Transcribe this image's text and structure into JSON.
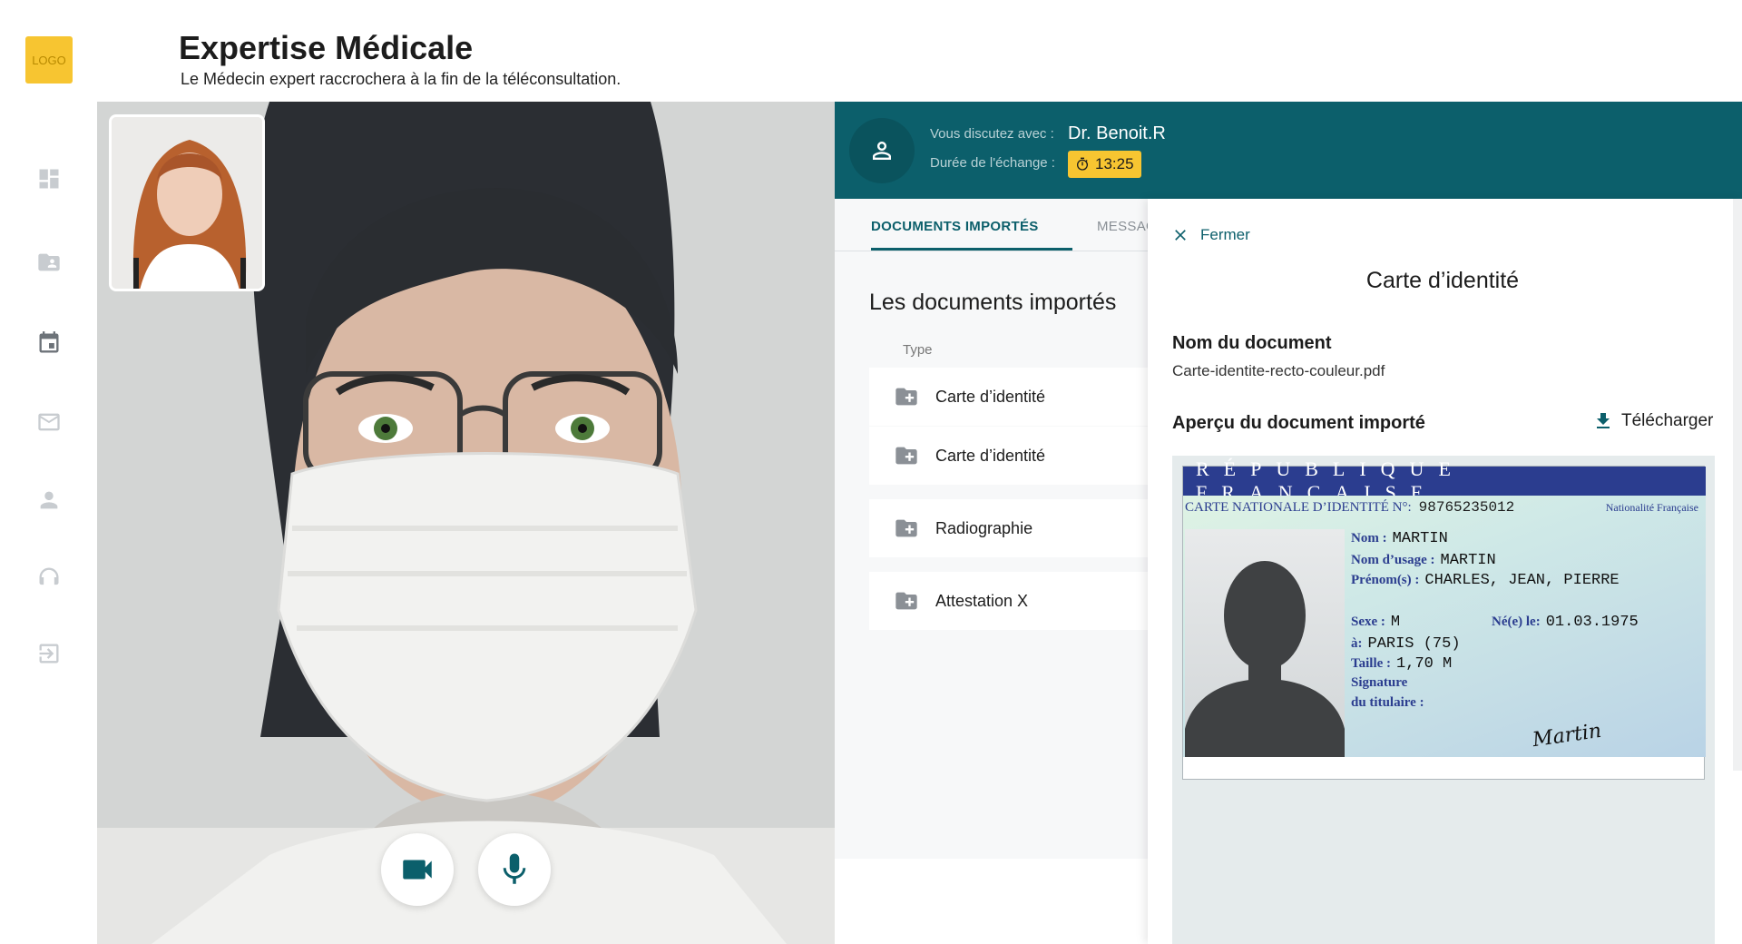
{
  "logo": "LOGO",
  "page": {
    "title": "Expertise Médicale",
    "subtitle": "Le Médecin expert raccrochera à la fin de la téléconsultation."
  },
  "sidebar": {
    "items": [
      {
        "icon": "dashboard-icon"
      },
      {
        "icon": "folder-user-icon"
      },
      {
        "icon": "calendar-icon"
      },
      {
        "icon": "mail-icon"
      },
      {
        "icon": "person-icon"
      },
      {
        "icon": "support-icon"
      },
      {
        "icon": "logout-icon"
      }
    ]
  },
  "chat": {
    "with_label": "Vous discutez avec :",
    "name": "Dr. Benoit.R",
    "duration_label": "Durée de l'échange :",
    "duration": "13:25"
  },
  "tabs": {
    "documents": "DOCUMENTS IMPORTÉS",
    "messages": "MESSAG"
  },
  "docs": {
    "title": "Les documents importés",
    "column_type": "Type",
    "items": [
      {
        "label": "Carte d’identité"
      },
      {
        "label": "Carte d’identité"
      },
      {
        "label": "Radiographie"
      },
      {
        "label": "Attestation X"
      }
    ]
  },
  "viewer": {
    "close_label": "Fermer",
    "title": "Carte d’identité",
    "name_label": "Nom du document",
    "name_value": "Carte-identite-recto-couleur.pdf",
    "preview_label": "Aperçu du document importé",
    "download_label": "Télécharger"
  },
  "id_card": {
    "band": "RÉPUBLIQUE FRANÇAISE",
    "card_label": "CARTE NATIONALE D’IDENTITÉ N°:",
    "card_number": "98765235012",
    "nationality": "Nationalité Française",
    "nom_label": "Nom :",
    "nom": "MARTIN",
    "usage_label": "Nom d’usage :",
    "usage": "MARTIN",
    "prenoms_label": "Prénom(s) :",
    "prenoms": "CHARLES, JEAN, PIERRE",
    "sexe_label": "Sexe :",
    "sexe": "M",
    "ne_label": "Né(e) le:",
    "ne": "01.03.1975",
    "lieu_label": "à:",
    "lieu": "PARIS (75)",
    "taille_label": "Taille :",
    "taille": "1,70 M",
    "signature_label_1": "Signature",
    "signature_label_2": "du titulaire :",
    "signature": "Martin"
  },
  "colors": {
    "primary": "#0c5f6b",
    "accent": "#f7c531",
    "card_blue": "#2b3d8f"
  }
}
